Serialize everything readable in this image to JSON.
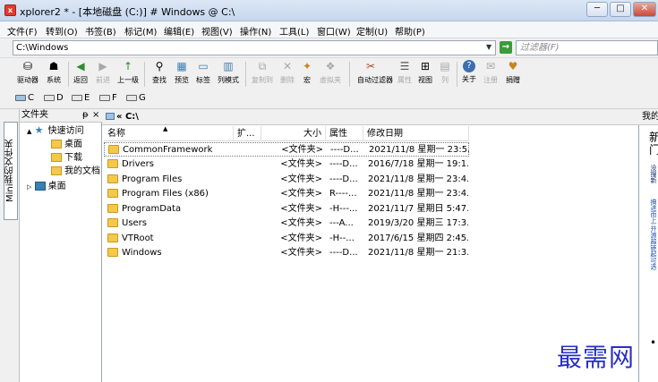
{
  "window": {
    "title": "xplorer2 * - [本地磁盘 (C:)] # Windows @ C:\\",
    "minimize": "─",
    "maximize": "□",
    "close": "✕"
  },
  "menu": [
    "文件(F)",
    "转到(O)",
    "书签(B)",
    "标记(M)",
    "编辑(E)",
    "视图(V)",
    "操作(N)",
    "工具(L)",
    "窗口(W)",
    "定制(U)",
    "帮助(P)"
  ],
  "address": {
    "value": "C:\\Windows",
    "filter_placeholder": "过滤器(F)"
  },
  "toolbar": [
    {
      "label": "驱动器",
      "icon": "drive-icon",
      "glyph": "⛁"
    },
    {
      "label": "系统",
      "icon": "system-icon",
      "glyph": "☗"
    },
    {
      "label": "返回",
      "icon": "back-icon",
      "glyph": "◀"
    },
    {
      "label": "前进",
      "icon": "forward-icon",
      "glyph": "▶"
    },
    {
      "label": "上一级",
      "icon": "up-icon",
      "glyph": "↑"
    },
    {
      "label": "查找",
      "icon": "find-icon",
      "glyph": "⚲"
    },
    {
      "label": "预览",
      "icon": "preview-icon",
      "glyph": "▦"
    },
    {
      "label": "标签",
      "icon": "tab-icon",
      "glyph": "▭"
    },
    {
      "label": "列模式",
      "icon": "column-mode-icon",
      "glyph": "▥"
    },
    {
      "label": "复制到",
      "icon": "copy-to-icon",
      "glyph": "⧉"
    },
    {
      "label": "删除",
      "icon": "delete-icon",
      "glyph": "✕"
    },
    {
      "label": "宏",
      "icon": "macro-icon",
      "glyph": "✦"
    },
    {
      "label": "虚拟夹",
      "icon": "virtual-folder-icon",
      "glyph": "❖"
    },
    {
      "label": "自动过滤器",
      "icon": "auto-filter-icon",
      "glyph": "✂"
    },
    {
      "label": "属性",
      "icon": "properties-icon",
      "glyph": "☰"
    },
    {
      "label": "视图",
      "icon": "view-icon",
      "glyph": "⊞"
    },
    {
      "label": "列",
      "icon": "columns-icon",
      "glyph": "▤"
    },
    {
      "label": "关于",
      "icon": "about-icon",
      "glyph": "?"
    },
    {
      "label": "注册",
      "icon": "register-icon",
      "glyph": "✉"
    },
    {
      "label": "捐赠",
      "icon": "donate-icon",
      "glyph": "♥"
    }
  ],
  "drives": [
    "C",
    "D",
    "E",
    "F",
    "G"
  ],
  "folder_panel": {
    "header": "文件夹",
    "pin": "ᵽ",
    "close": "×",
    "vertical_tab": "Mini我的文件夹",
    "tree": [
      {
        "label": "快速访问",
        "expander": "▲"
      },
      {
        "label": "桌面"
      },
      {
        "label": "下载"
      },
      {
        "label": "我的文档"
      },
      {
        "label": "桌面",
        "expander": "▷"
      }
    ]
  },
  "main": {
    "path": "« C:\\",
    "columns": [
      "名称",
      "扩...",
      "大小",
      "属性",
      "修改日期"
    ],
    "rows": [
      {
        "name": "CommonFramework",
        "size": "<文件夹>",
        "attr": "----D...",
        "date": "2021/11/8 星期一 23:5..."
      },
      {
        "name": "Drivers",
        "size": "<文件夹>",
        "attr": "----D...",
        "date": "2016/7/18 星期一 19:1..."
      },
      {
        "name": "Program Files",
        "size": "<文件夹>",
        "attr": "----D...",
        "date": "2021/11/8 星期一 23:4..."
      },
      {
        "name": "Program Files (x86)",
        "size": "<文件夹>",
        "attr": "R----...",
        "date": "2021/11/8 星期一 23:4..."
      },
      {
        "name": "ProgramData",
        "size": "<文件夹>",
        "attr": "-H---...",
        "date": "2021/11/7 星期日 5:47..."
      },
      {
        "name": "Users",
        "size": "<文件夹>",
        "attr": "---A...",
        "date": "2019/3/20 星期三 17:3..."
      },
      {
        "name": "VTRoot",
        "size": "<文件夹>",
        "attr": "-H--...",
        "date": "2017/6/15 星期四 2:45..."
      },
      {
        "name": "Windows",
        "size": "<文件夹>",
        "attr": "----D...",
        "date": "2021/11/8 星期一 21:3..."
      }
    ]
  },
  "right_panel": {
    "header": "我的",
    "big_text": "新门",
    "snippet1": "没搜新",
    "snippet2": "搞进而上:开源超链起可选",
    "bullet": "•"
  },
  "watermark": "最需网",
  "colors": {
    "accent": "#3c7fb1",
    "folder": "#f3c84b",
    "watermark": "#2a2fbf"
  }
}
